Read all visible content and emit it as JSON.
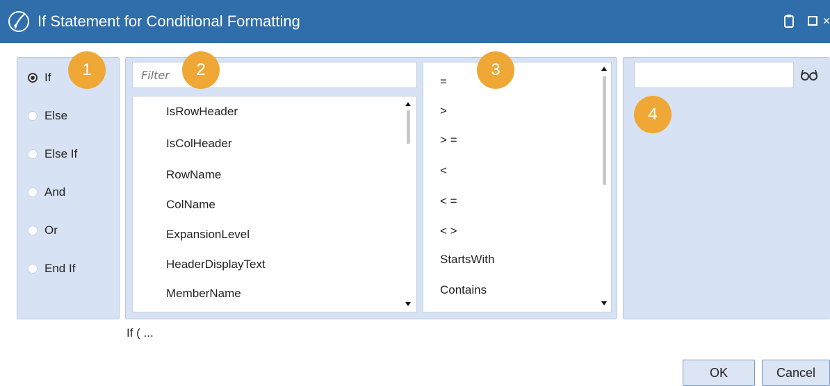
{
  "window": {
    "title": "If Statement for Conditional Formatting"
  },
  "colors": {
    "titlebar": "#2f6dab",
    "panel": "#d7e2f4",
    "badge": "#efa736",
    "button": "#dbe5f3"
  },
  "keywords": {
    "items": [
      {
        "label": "If",
        "selected": true
      },
      {
        "label": "Else",
        "selected": false
      },
      {
        "label": "Else If",
        "selected": false
      },
      {
        "label": "And",
        "selected": false
      },
      {
        "label": "Or",
        "selected": false
      },
      {
        "label": "End If",
        "selected": false
      }
    ]
  },
  "badges": [
    "1",
    "2",
    "3",
    "4"
  ],
  "filter": {
    "placeholder": "Filter",
    "value": ""
  },
  "properties": {
    "items": [
      "IsRowHeader",
      "IsColHeader",
      "RowName",
      "ColName",
      "ExpansionLevel",
      "HeaderDisplayText",
      "MemberName"
    ]
  },
  "operators": {
    "items": [
      "=",
      ">",
      "> =",
      "<",
      "< =",
      "< >",
      "StartsWith",
      "Contains"
    ]
  },
  "value_field": {
    "value": "",
    "icon": "glasses-icon"
  },
  "expression_preview": "If ( ...",
  "buttons": {
    "ok": "OK",
    "cancel": "Cancel"
  }
}
